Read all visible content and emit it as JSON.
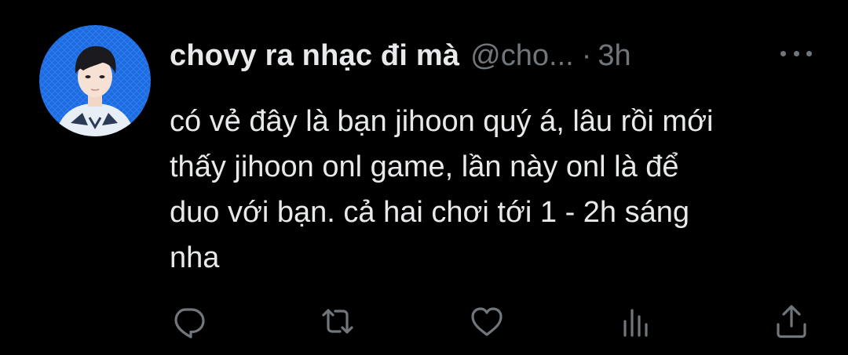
{
  "tweet": {
    "display_name": "chovy ra nhạc đi mà",
    "handle": "@cho...",
    "separator": "·",
    "time": "3h",
    "text_lines": [
      "có vẻ đây là bạn jihoon quý á, lâu rồi mới",
      "thấy jihoon onl game, lần này onl là để",
      "duo với bạn. cả hai chơi tới 1 - 2h sáng",
      "nha"
    ]
  },
  "icons": {
    "avatar": "avatar-image",
    "more": "more-options-icon",
    "reply": "reply-icon",
    "retweet": "retweet-icon",
    "like": "like-icon",
    "views": "views-icon",
    "share": "share-icon"
  },
  "colors": {
    "background": "#000000",
    "primary_text": "#e7e9ea",
    "secondary_text": "#71767b",
    "avatar_bg": "#1f6fe0"
  }
}
